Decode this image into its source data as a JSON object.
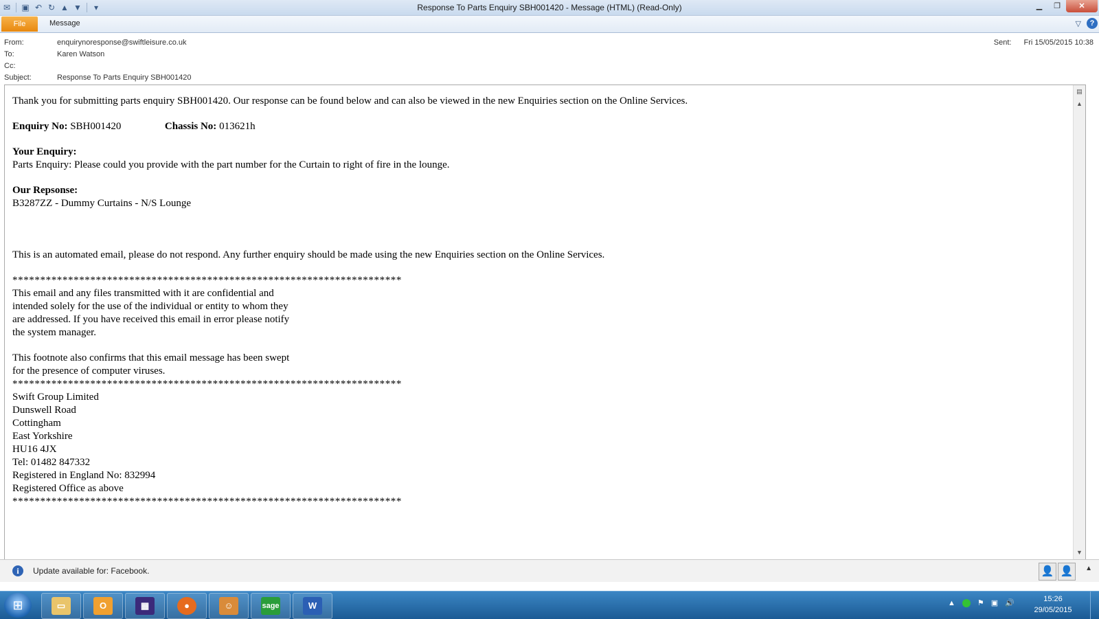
{
  "window": {
    "title": "Response To Parts Enquiry SBH001420  -  Message (HTML) (Read-Only)",
    "qat_icons": [
      "envelope-icon",
      "save-icon",
      "undo-icon",
      "redo-icon",
      "up-arrow-icon",
      "down-arrow-icon",
      "customize-icon"
    ],
    "controls": [
      "minimize-icon",
      "restore-icon",
      "close-icon"
    ]
  },
  "ribbon": {
    "file_label": "File",
    "message_label": "Message"
  },
  "header": {
    "from_label": "From:",
    "from_value": "enquirynoresponse@swiftleisure.co.uk",
    "to_label": "To:",
    "to_value": "Karen Watson",
    "cc_label": "Cc:",
    "cc_value": "",
    "subject_label": "Subject:",
    "subject_value": "Response To Parts Enquiry SBH001420",
    "sent_label": "Sent:",
    "sent_value": "Fri 15/05/2015 10:38"
  },
  "body": {
    "intro": "Thank you for submitting parts enquiry SBH001420. Our response can be found below and can also be viewed in the new Enquiries section on the Online Services.",
    "enquiry_no_label": "Enquiry No:",
    "enquiry_no_value": "SBH001420",
    "chassis_no_label": "Chassis No:",
    "chassis_no_value": "013621h",
    "your_enquiry_label": "Your Enquiry:",
    "your_enquiry_text": "Parts Enquiry: Please could you provide with the part number for the Curtain to right of fire in the lounge.",
    "our_response_label": "Our Repsonse:",
    "our_response_text": "B3287ZZ - Dummy Curtains - N/S Lounge",
    "automated_note": "This is an automated email, please do not respond. Any further enquiry should be made using the new Enquiries section on the Online Services.",
    "stars": "**********************************************************************",
    "disclaimer_lines": [
      "This email and any files transmitted with it are confidential and",
      "intended solely for the use of the individual or entity to whom they",
      "are addressed. If you have received this email in error please notify",
      "the system manager."
    ],
    "footnote_lines": [
      "This footnote also confirms that this email message has been swept",
      "for the presence of computer viruses."
    ],
    "address_lines": [
      "Swift Group Limited",
      "Dunswell Road",
      "Cottingham",
      "East Yorkshire",
      "HU16 4JX",
      "Tel: 01482 847332",
      "Registered in England No: 832994",
      "Registered Office as above"
    ]
  },
  "infobar": {
    "text": "Update available for: Facebook."
  },
  "taskbar": {
    "apps": [
      "windows-explorer",
      "outlook",
      "calculator-app",
      "firefox",
      "contacts-app",
      "sage",
      "word"
    ],
    "sage_label": "sage",
    "word_label": "W",
    "time": "15:26",
    "date": "29/05/2015"
  },
  "colors": {
    "file_tab": "#e8880f",
    "taskbar": "#1b5a94",
    "close_button": "#c94e3a",
    "info_icon": "#2f64b5"
  }
}
